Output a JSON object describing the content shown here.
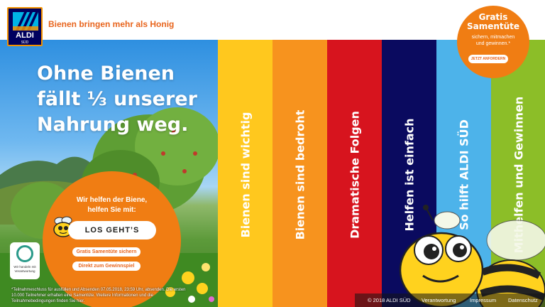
{
  "header": {
    "logo_text": "ALDI",
    "logo_sub": "SÜD",
    "tagline": "Bienen bringen mehr als Honig"
  },
  "hero": {
    "headline_line1": "Ohne Bienen",
    "headline_line2": "fällt ⅓ unserer",
    "headline_line3": "Nahrung weg.",
    "circle_line1": "Wir helfen der Biene,",
    "circle_line2": "helfen Sie mit:",
    "cta_label": "LOS GEHT’S",
    "pill1_label": "Gratis Samentüte sichern",
    "pill2_label": "Direkt zum Gewinnspiel",
    "badge_line1": "Wir handeln mit",
    "badge_line2": "Verantwortung",
    "legal_line1": "*Teilnahmeschluss für ausfüllen und Absenden 07.05.2018, 23:59 Uhr, absenden. Die ersten",
    "legal_line2": "10.000 Teilnehmer erhalten eine Samentüte. Weitere Informationen und die",
    "legal_line3": "Teilnahmebedingungen finden Sie hier."
  },
  "strips": [
    {
      "label": "Bienen sind wichtig",
      "color": "#ffc81e"
    },
    {
      "label": "Bienen sind bedroht",
      "color": "#f7931e"
    },
    {
      "label": "Dramatische Folgen",
      "color": "#d7141e"
    },
    {
      "label": "Helfen ist einfach",
      "color": "#0a0a5f"
    },
    {
      "label": "So hilft ALDI SÜD",
      "color": "#4db3ea"
    },
    {
      "label": "Mithelfen und Gewinnen",
      "color": "#8cbe28"
    }
  ],
  "promo": {
    "title_line1": "Gratis",
    "title_line2": "Samentüte",
    "sub_line1": "sichern, mitmachen",
    "sub_line2": "und gewinnen.*",
    "button_label": "JETZT ANFORDERN"
  },
  "footer": {
    "copyright": "© 2018 ALDI SÜD",
    "link1": "Verantwortung",
    "link2": "Impressum",
    "link3": "Datenschutz"
  },
  "colors": {
    "accent_orange": "#f07d13",
    "aldi_blue": "#00005f"
  }
}
